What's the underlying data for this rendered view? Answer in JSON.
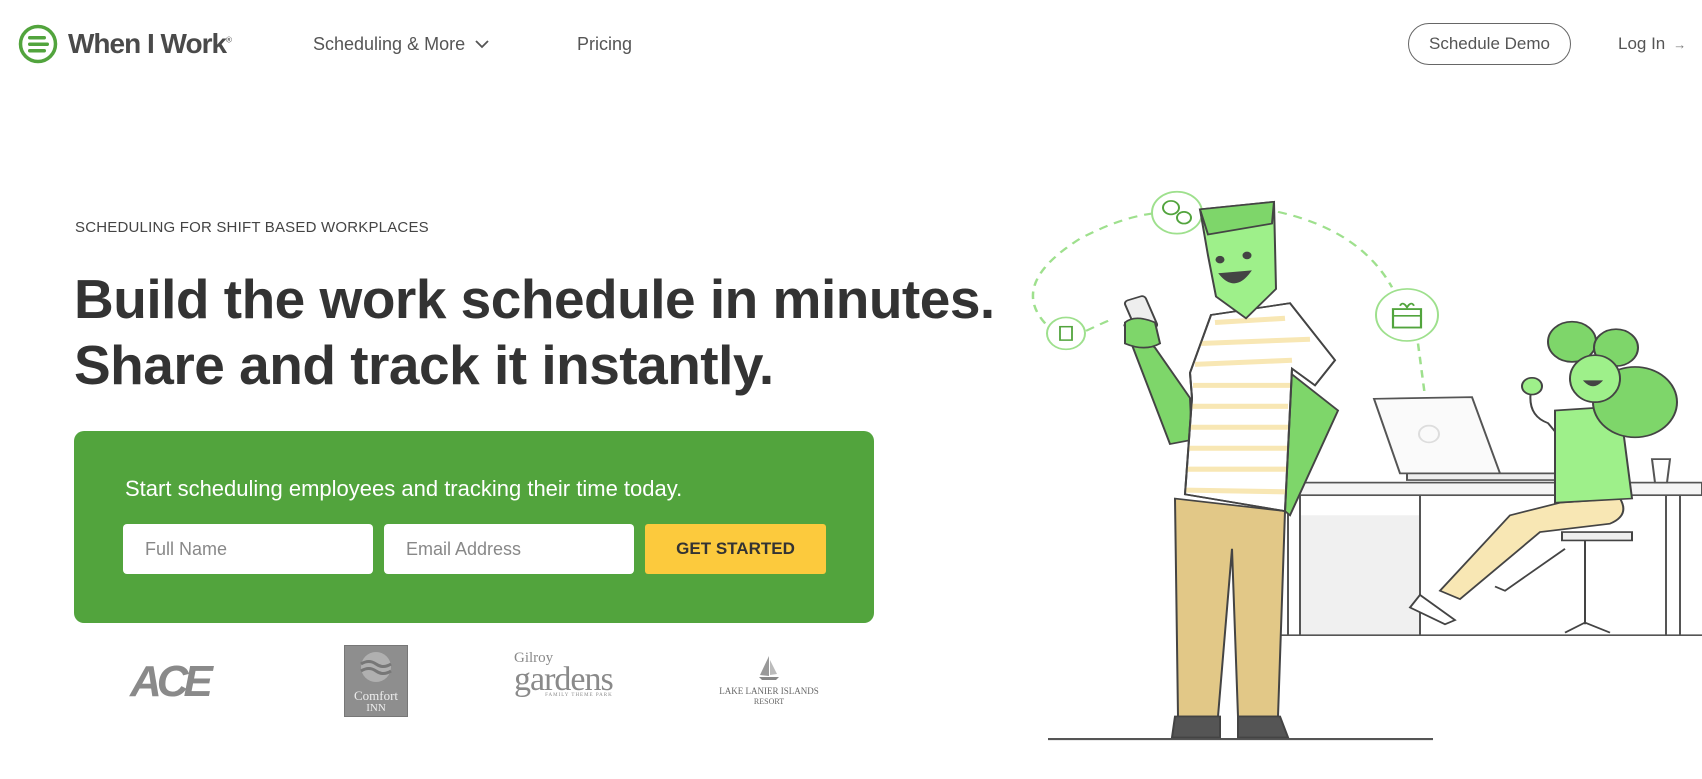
{
  "header": {
    "brand": "When I Work",
    "brand_mark": "®",
    "nav": [
      {
        "label": "Scheduling & More",
        "icon": "chevron-down-icon"
      },
      {
        "label": "Pricing"
      }
    ],
    "schedule_demo_label": "Schedule Demo",
    "login_label": "Log In",
    "login_icon": "arrow-right-icon"
  },
  "hero": {
    "eyebrow": "SCHEDULING FOR SHIFT BASED WORKPLACES",
    "headline_line1": "Build the work schedule in minutes.",
    "headline_line2": "Share and track it instantly.",
    "cta": {
      "subtitle": "Start scheduling employees and tracking their time today.",
      "name_placeholder": "Full Name",
      "email_placeholder": "Email Address",
      "button_label": "GET STARTED"
    }
  },
  "customer_logos": {
    "ace": "ACE",
    "comfort_inn": [
      "Comfort",
      "INN"
    ],
    "gilroy": [
      "Gilroy",
      "gardens",
      "FAMILY THEME PARK"
    ],
    "lake_lanier": [
      "LAKE LANIER ISLANDS",
      "RESORT"
    ]
  },
  "colors": {
    "brand_green": "#52a43d",
    "cta_yellow": "#fcca3d",
    "illustration_green": "#7ed66a",
    "text_dark": "#333333"
  }
}
